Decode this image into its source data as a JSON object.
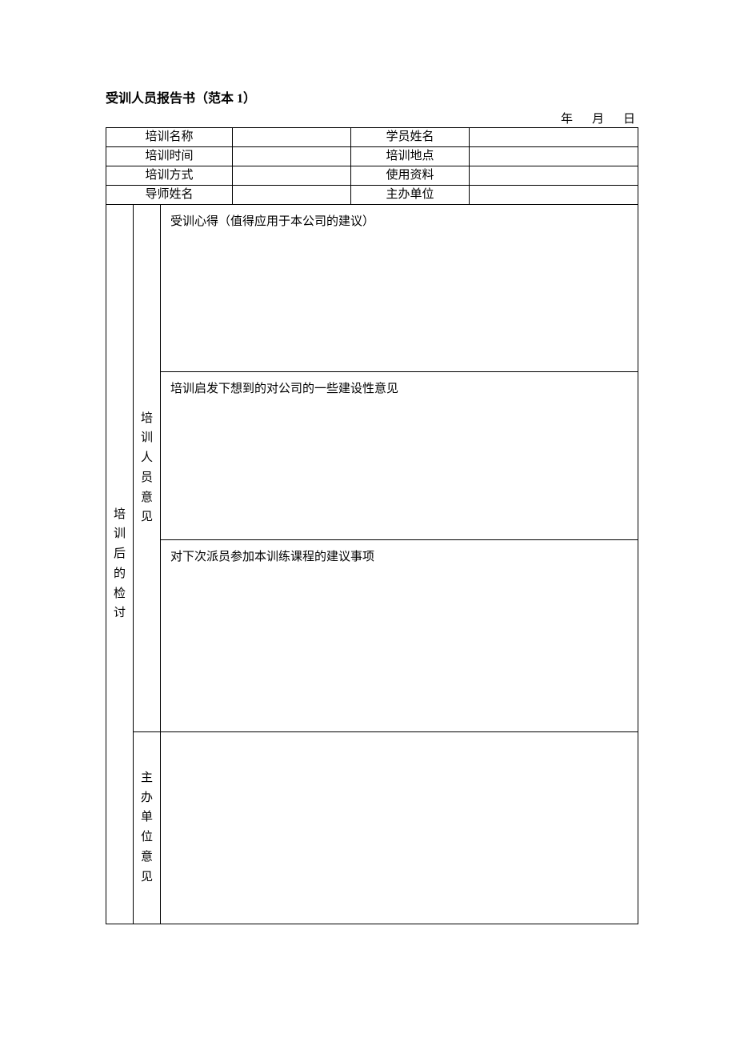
{
  "title": "受训人员报告书（范本 1）",
  "date": {
    "year": "年",
    "month": "月",
    "day": "日"
  },
  "info": {
    "r1": {
      "l1": "培训名称",
      "v1": "",
      "l2": "学员姓名",
      "v2": ""
    },
    "r2": {
      "l1": "培训时间",
      "v1": "",
      "l2": "培训地点",
      "v2": ""
    },
    "r3": {
      "l1": "培训方式",
      "v1": "",
      "l2": "使用资料",
      "v2": ""
    },
    "r4": {
      "l1": "导师姓名",
      "v1": "",
      "l2": "主办单位",
      "v2": ""
    }
  },
  "vcols": {
    "outer": [
      "培",
      "训",
      "后",
      "的",
      "检",
      "讨"
    ],
    "inner1": [
      "培",
      "训",
      "人",
      "员",
      "意",
      "见"
    ],
    "inner2": [
      "主",
      "办",
      "单",
      "位",
      "意",
      "见"
    ]
  },
  "sections": {
    "sx": "受训心得（值得应用于本公司的建议）",
    "qf": "培训启发下想到的对公司的一些建设性意见",
    "jy": "对下次派员参加本训练课程的建议事项",
    "zb": ""
  }
}
